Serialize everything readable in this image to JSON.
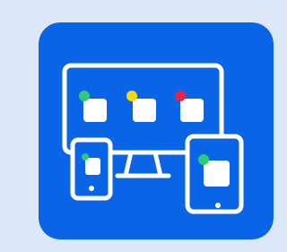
{
  "icon": {
    "name": "multi-device-sync-icon",
    "colors": {
      "page_background": "#dce8f7",
      "tile_background": "#0a64e6",
      "outline": "#ffffff",
      "app_square": "#ffffff",
      "dot_green": "#2ecc71",
      "dot_yellow": "#f5d90a",
      "dot_red": "#e8234a"
    },
    "devices": [
      "monitor-icon",
      "phone-icon",
      "tablet-icon"
    ]
  }
}
